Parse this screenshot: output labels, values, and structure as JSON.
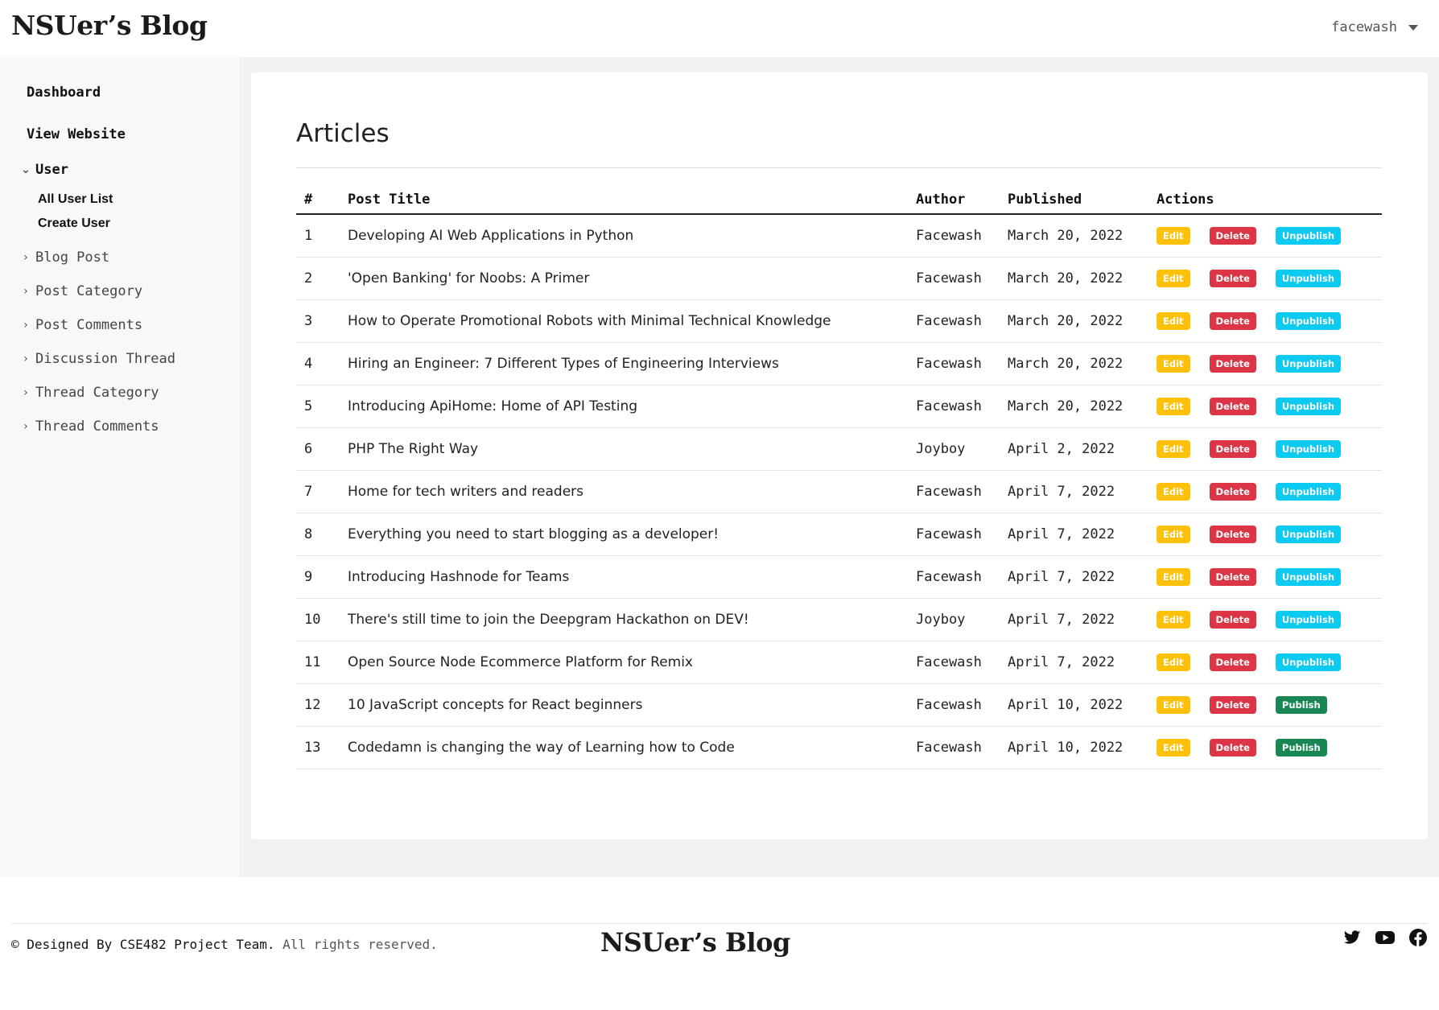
{
  "header": {
    "brand": "NSUer’s Blog",
    "username": "facewash"
  },
  "sidebar": {
    "dashboard": "Dashboard",
    "view_website": "View Website",
    "user_group": "User",
    "user_subitems": [
      "All User List",
      "Create User"
    ],
    "groups": [
      "Blog Post",
      "Post Category",
      "Post Comments",
      "Discussion Thread",
      "Thread Category",
      "Thread Comments"
    ]
  },
  "main": {
    "title": "Articles",
    "columns": [
      "#",
      "Post Title",
      "Author",
      "Published",
      "Actions"
    ],
    "actions": {
      "edit": "Edit",
      "delete": "Delete",
      "unpublish": "Unpublish",
      "publish": "Publish"
    },
    "rows": [
      {
        "num": "1",
        "title": "Developing AI Web Applications in Python",
        "author": "Facewash",
        "published": "March 20, 2022",
        "status": "unpublish"
      },
      {
        "num": "2",
        "title": "'Open Banking' for Noobs: A Primer",
        "author": "Facewash",
        "published": "March 20, 2022",
        "status": "unpublish"
      },
      {
        "num": "3",
        "title": "How to Operate Promotional Robots with Minimal Technical Knowledge",
        "author": "Facewash",
        "published": "March 20, 2022",
        "status": "unpublish"
      },
      {
        "num": "4",
        "title": "Hiring an Engineer: 7 Different Types of Engineering Interviews",
        "author": "Facewash",
        "published": "March 20, 2022",
        "status": "unpublish"
      },
      {
        "num": "5",
        "title": "Introducing ApiHome: Home of API Testing",
        "author": "Facewash",
        "published": "March 20, 2022",
        "status": "unpublish"
      },
      {
        "num": "6",
        "title": "PHP The Right Way",
        "author": "Joyboy",
        "published": "April 2, 2022",
        "status": "unpublish"
      },
      {
        "num": "7",
        "title": "Home for tech writers and readers",
        "author": "Facewash",
        "published": "April 7, 2022",
        "status": "unpublish"
      },
      {
        "num": "8",
        "title": "Everything you need to start blogging as a developer!",
        "author": "Facewash",
        "published": "April 7, 2022",
        "status": "unpublish"
      },
      {
        "num": "9",
        "title": "Introducing Hashnode for Teams",
        "author": "Facewash",
        "published": "April 7, 2022",
        "status": "unpublish"
      },
      {
        "num": "10",
        "title": "There's still time to join the Deepgram Hackathon on DEV!",
        "author": "Joyboy",
        "published": "April 7, 2022",
        "status": "unpublish"
      },
      {
        "num": "11",
        "title": "Open Source Node Ecommerce Platform for Remix",
        "author": "Facewash",
        "published": "April 7, 2022",
        "status": "unpublish"
      },
      {
        "num": "12",
        "title": "10 JavaScript concepts for React beginners",
        "author": "Facewash",
        "published": "April 10, 2022",
        "status": "publish"
      },
      {
        "num": "13",
        "title": "Codedamn is changing the way of Learning how to Code",
        "author": "Facewash",
        "published": "April 10, 2022",
        "status": "publish"
      }
    ]
  },
  "footer": {
    "copyright_prefix": "© Designed By CSE482 Project Team.",
    "copyright_suffix": "All rights reserved.",
    "brand": "NSUer’s Blog",
    "social_icons": [
      "twitter-icon",
      "youtube-icon",
      "facebook-icon"
    ]
  },
  "colors": {
    "edit": "#ffc107",
    "delete": "#dc3545",
    "unpublish": "#0dcaf0",
    "publish": "#198754"
  }
}
